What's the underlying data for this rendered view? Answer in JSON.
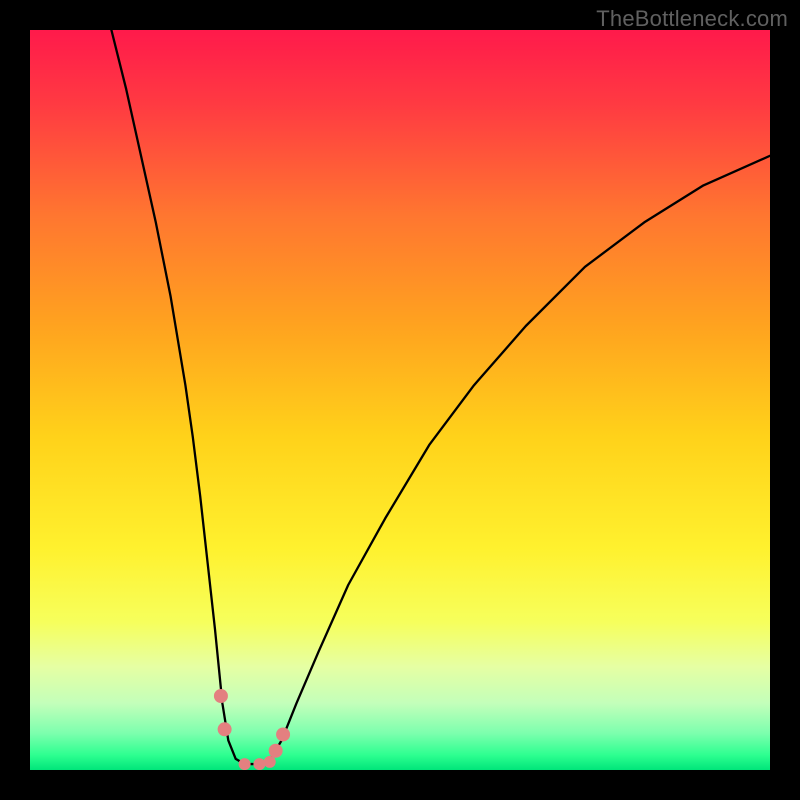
{
  "watermark": "TheBottleneck.com",
  "chart_data": {
    "type": "line",
    "title": "",
    "xlabel": "",
    "ylabel": "",
    "xlim": [
      0,
      100
    ],
    "ylim": [
      0,
      100
    ],
    "curve": {
      "name": "bottleneck-curve",
      "points": [
        {
          "x": 11,
          "y": 100
        },
        {
          "x": 13,
          "y": 92
        },
        {
          "x": 15,
          "y": 83
        },
        {
          "x": 17,
          "y": 74
        },
        {
          "x": 19,
          "y": 64
        },
        {
          "x": 21,
          "y": 52
        },
        {
          "x": 22,
          "y": 45
        },
        {
          "x": 23,
          "y": 37
        },
        {
          "x": 24,
          "y": 28
        },
        {
          "x": 25,
          "y": 19
        },
        {
          "x": 25.5,
          "y": 14
        },
        {
          "x": 26,
          "y": 9
        },
        {
          "x": 26.8,
          "y": 4
        },
        {
          "x": 27.8,
          "y": 1.5
        },
        {
          "x": 29,
          "y": 0.8
        },
        {
          "x": 31,
          "y": 0.8
        },
        {
          "x": 32.5,
          "y": 1.5
        },
        {
          "x": 34,
          "y": 4
        },
        {
          "x": 36,
          "y": 9
        },
        {
          "x": 39,
          "y": 16
        },
        {
          "x": 43,
          "y": 25
        },
        {
          "x": 48,
          "y": 34
        },
        {
          "x": 54,
          "y": 44
        },
        {
          "x": 60,
          "y": 52
        },
        {
          "x": 67,
          "y": 60
        },
        {
          "x": 75,
          "y": 68
        },
        {
          "x": 83,
          "y": 74
        },
        {
          "x": 91,
          "y": 79
        },
        {
          "x": 100,
          "y": 83
        }
      ]
    },
    "markers": [
      {
        "x": 25.8,
        "y": 10.0,
        "r": 7
      },
      {
        "x": 26.3,
        "y": 5.5,
        "r": 7
      },
      {
        "x": 29.0,
        "y": 0.8,
        "r": 6
      },
      {
        "x": 31.0,
        "y": 0.8,
        "r": 6
      },
      {
        "x": 32.4,
        "y": 1.1,
        "r": 6
      },
      {
        "x": 33.2,
        "y": 2.6,
        "r": 7
      },
      {
        "x": 34.2,
        "y": 4.8,
        "r": 7
      }
    ],
    "gradient_stops": [
      {
        "offset": 0.0,
        "color": "#ff1a4b"
      },
      {
        "offset": 0.1,
        "color": "#ff3a42"
      },
      {
        "offset": 0.25,
        "color": "#ff7630"
      },
      {
        "offset": 0.4,
        "color": "#ffa31f"
      },
      {
        "offset": 0.55,
        "color": "#ffd21a"
      },
      {
        "offset": 0.7,
        "color": "#fff12e"
      },
      {
        "offset": 0.8,
        "color": "#f6ff5c"
      },
      {
        "offset": 0.86,
        "color": "#e6ffa3"
      },
      {
        "offset": 0.91,
        "color": "#c3ffba"
      },
      {
        "offset": 0.95,
        "color": "#7dffae"
      },
      {
        "offset": 0.98,
        "color": "#2dff90"
      },
      {
        "offset": 1.0,
        "color": "#00e57a"
      }
    ],
    "marker_color": "#e38080",
    "curve_color": "#000000"
  }
}
